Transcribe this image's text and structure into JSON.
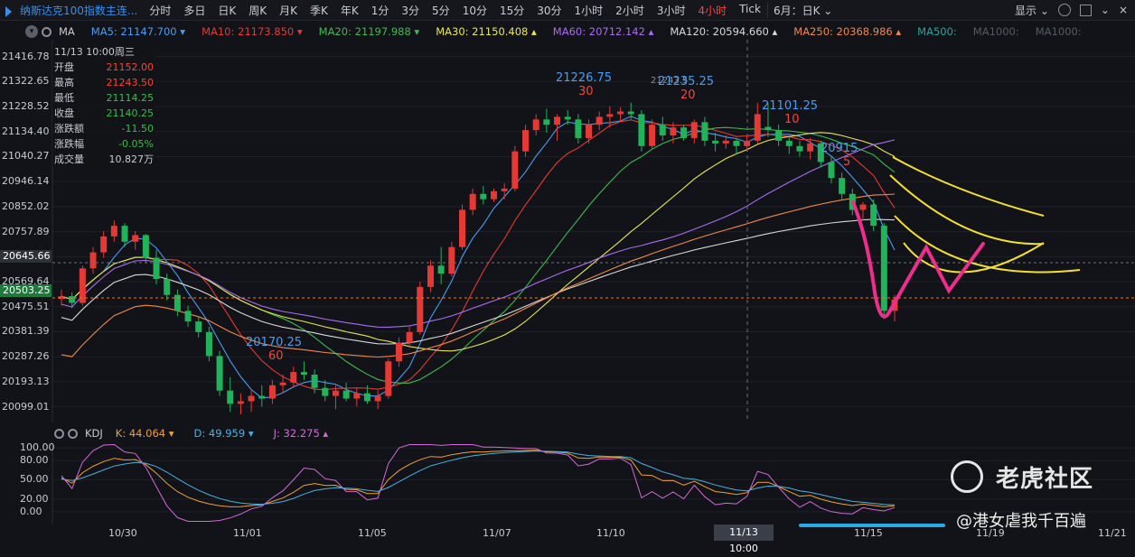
{
  "toolbar": {
    "title": "纳斯达克100指数主连...",
    "periods": [
      "分时",
      "多日",
      "日K",
      "周K",
      "月K",
      "季K",
      "年K",
      "1分",
      "3分",
      "5分",
      "10分",
      "15分",
      "30分",
      "1小时",
      "2小时",
      "3小时",
      "4小时",
      "Tick"
    ],
    "active_period": "4小时",
    "range_select": "6月：日K",
    "display_label": "显示"
  },
  "ma_bar": {
    "indicator": "MA",
    "items": [
      {
        "label": "MA5: 21147.700 ▾",
        "color": "#4a9df0"
      },
      {
        "label": "MA10: 21173.850 ▾",
        "color": "#e53935"
      },
      {
        "label": "MA20: 21197.988 ▾",
        "color": "#3fb950"
      },
      {
        "label": "MA30: 21150.408 ▴",
        "color": "#e8e84a"
      },
      {
        "label": "MA60: 20712.142 ▴",
        "color": "#a86df0"
      },
      {
        "label": "MA120: 20594.660 ▴",
        "color": "#d8d8d8"
      },
      {
        "label": "MA250: 20368.986 ▴",
        "color": "#f0884a"
      },
      {
        "label": "MA500:",
        "color": "#2aa59a"
      },
      {
        "label": "MA1000:",
        "color": "#555a63"
      },
      {
        "label": "MA1000:",
        "color": "#555a63"
      }
    ]
  },
  "info_panel": {
    "header": "11/13 10:00周三",
    "rows": [
      {
        "k": "开盘",
        "v": "21152.00",
        "c": "#f0473f"
      },
      {
        "k": "最高",
        "v": "21243.50",
        "c": "#f0473f"
      },
      {
        "k": "最低",
        "v": "21114.25",
        "c": "#3fb950"
      },
      {
        "k": "收盘",
        "v": "21140.25",
        "c": "#3fb950"
      },
      {
        "k": "涨跌额",
        "v": "-11.50",
        "c": "#3fb950"
      },
      {
        "k": "涨跌幅",
        "v": "-0.05%",
        "c": "#3fb950"
      },
      {
        "k": "成交量",
        "v": "10.827万",
        "c": "#c8ccd4"
      }
    ]
  },
  "price_axis": [
    "21416.78",
    "21322.65",
    "21228.52",
    "21134.40",
    "21040.27",
    "20946.14",
    "20852.02",
    "20757.89",
    "20663.77",
    "20569.64",
    "20475.51",
    "20381.39",
    "20287.26",
    "20193.13",
    "20099.01"
  ],
  "price_tags": [
    {
      "label": "20645.66",
      "bg": "#2d3138"
    },
    {
      "label": "20503.25",
      "bg": "#1e7a3c"
    }
  ],
  "kdj_bar": {
    "indicator": "KDJ",
    "k": "K: 44.064 ▾",
    "d": "D: 49.959 ▾",
    "j": "J: 32.275 ▴"
  },
  "kdj_axis": [
    "100.00",
    "80.00",
    "50.00",
    "20.00",
    "0.00"
  ],
  "x_axis": [
    "10/30",
    "11/01",
    "11/05",
    "11/07",
    "11/10",
    "11/15",
    "11/19",
    "11/21"
  ],
  "x_cursor": "11/13 10:00",
  "annotations": [
    {
      "value": "21226.75",
      "num": "30"
    },
    {
      "value": "21235.25",
      "num": "20"
    },
    {
      "value": "21101.25",
      "num": "10"
    },
    {
      "value": "20915",
      "num": "5"
    },
    {
      "value": "20170.25",
      "num": "60"
    },
    {
      "value": "21243.5"
    }
  ],
  "watermark": {
    "brand": "老虎社区",
    "user": "@港女虐我千百遍"
  },
  "chart_data": {
    "type": "candlestick",
    "candles": [
      [
        20505,
        20540,
        20480,
        20515
      ],
      [
        20515,
        20530,
        20470,
        20490
      ],
      [
        20490,
        20630,
        20480,
        20620
      ],
      [
        20620,
        20700,
        20600,
        20680
      ],
      [
        20680,
        20760,
        20660,
        20740
      ],
      [
        20740,
        20800,
        20720,
        20780
      ],
      [
        20780,
        20790,
        20700,
        20720
      ],
      [
        20720,
        20760,
        20690,
        20745
      ],
      [
        20745,
        20750,
        20640,
        20660
      ],
      [
        20660,
        20690,
        20560,
        20580
      ],
      [
        20580,
        20600,
        20500,
        20520
      ],
      [
        20520,
        20540,
        20440,
        20460
      ],
      [
        20460,
        20480,
        20400,
        20420
      ],
      [
        20420,
        20440,
        20360,
        20380
      ],
      [
        20380,
        20400,
        20270,
        20290
      ],
      [
        20290,
        20310,
        20140,
        20160
      ],
      [
        20160,
        20210,
        20080,
        20110
      ],
      [
        20110,
        20150,
        20070,
        20120
      ],
      [
        20120,
        20160,
        20080,
        20140
      ],
      [
        20140,
        20180,
        20100,
        20130
      ],
      [
        20130,
        20200,
        20110,
        20180
      ],
      [
        20180,
        20220,
        20150,
        20190
      ],
      [
        20190,
        20250,
        20170,
        20230
      ],
      [
        20230,
        20270,
        20200,
        20220
      ],
      [
        20220,
        20240,
        20150,
        20170
      ],
      [
        20170,
        20200,
        20120,
        20140
      ],
      [
        20140,
        20180,
        20090,
        20160
      ],
      [
        20160,
        20190,
        20120,
        20130
      ],
      [
        20130,
        20170,
        20100,
        20150
      ],
      [
        20150,
        20180,
        20110,
        20120
      ],
      [
        20120,
        20160,
        20090,
        20140
      ],
      [
        20140,
        20280,
        20130,
        20270
      ],
      [
        20270,
        20360,
        20250,
        20340
      ],
      [
        20340,
        20400,
        20320,
        20380
      ],
      [
        20380,
        20570,
        20370,
        20550
      ],
      [
        20550,
        20650,
        20530,
        20630
      ],
      [
        20630,
        20700,
        20560,
        20600
      ],
      [
        20600,
        20720,
        20590,
        20700
      ],
      [
        20700,
        20860,
        20690,
        20840
      ],
      [
        20840,
        20920,
        20820,
        20900
      ],
      [
        20900,
        20930,
        20860,
        20880
      ],
      [
        20880,
        20920,
        20870,
        20910
      ],
      [
        20910,
        20940,
        20880,
        20920
      ],
      [
        20920,
        21080,
        20910,
        21060
      ],
      [
        21060,
        21160,
        21040,
        21140
      ],
      [
        21140,
        21200,
        21120,
        21180
      ],
      [
        21180,
        21220,
        21130,
        21160
      ],
      [
        21160,
        21200,
        21100,
        21190
      ],
      [
        21190,
        21215,
        21160,
        21180
      ],
      [
        21180,
        21200,
        21090,
        21110
      ],
      [
        21110,
        21180,
        21090,
        21160
      ],
      [
        21160,
        21210,
        21140,
        21190
      ],
      [
        21190,
        21230,
        21150,
        21200
      ],
      [
        21200,
        21226,
        21170,
        21210
      ],
      [
        21210,
        21243,
        21180,
        21200
      ],
      [
        21200,
        21215,
        21060,
        21080
      ],
      [
        21080,
        21180,
        21070,
        21160
      ],
      [
        21160,
        21190,
        21100,
        21120
      ],
      [
        21120,
        21170,
        21090,
        21150
      ],
      [
        21150,
        21160,
        21100,
        21110
      ],
      [
        21110,
        21180,
        21090,
        21170
      ],
      [
        21170,
        21190,
        21080,
        21100
      ],
      [
        21100,
        21130,
        21060,
        21090
      ],
      [
        21090,
        21120,
        21070,
        21100
      ],
      [
        21100,
        21110,
        21050,
        21080
      ],
      [
        21080,
        21120,
        21060,
        21100
      ],
      [
        21100,
        21243,
        21090,
        21200
      ],
      [
        21152,
        21243,
        21114,
        21140
      ],
      [
        21140,
        21160,
        21080,
        21100
      ],
      [
        21100,
        21120,
        21050,
        21080
      ],
      [
        21080,
        21100,
        21040,
        21060
      ],
      [
        21060,
        21110,
        21030,
        21090
      ],
      [
        21090,
        21100,
        21000,
        21020
      ],
      [
        21020,
        21040,
        20940,
        20960
      ],
      [
        20960,
        20980,
        20880,
        20900
      ],
      [
        20900,
        20920,
        20820,
        20840
      ],
      [
        20840,
        20870,
        20800,
        20860
      ],
      [
        20860,
        20880,
        20760,
        20780
      ],
      [
        20780,
        20790,
        20430,
        20460
      ],
      [
        20460,
        20520,
        20420,
        20503
      ]
    ],
    "price_range": [
      20040,
      21480
    ],
    "series_lines": [
      {
        "name": "MA5",
        "color": "#4a9df0"
      },
      {
        "name": "MA10",
        "color": "#e53935"
      },
      {
        "name": "MA20",
        "color": "#3fb950"
      },
      {
        "name": "MA30",
        "color": "#e8e84a"
      },
      {
        "name": "MA60",
        "color": "#a86df0"
      },
      {
        "name": "MA120",
        "color": "#d8d8d8"
      },
      {
        "name": "MA250",
        "color": "#f0884a"
      }
    ],
    "kdj_range": [
      -20,
      110
    ]
  }
}
